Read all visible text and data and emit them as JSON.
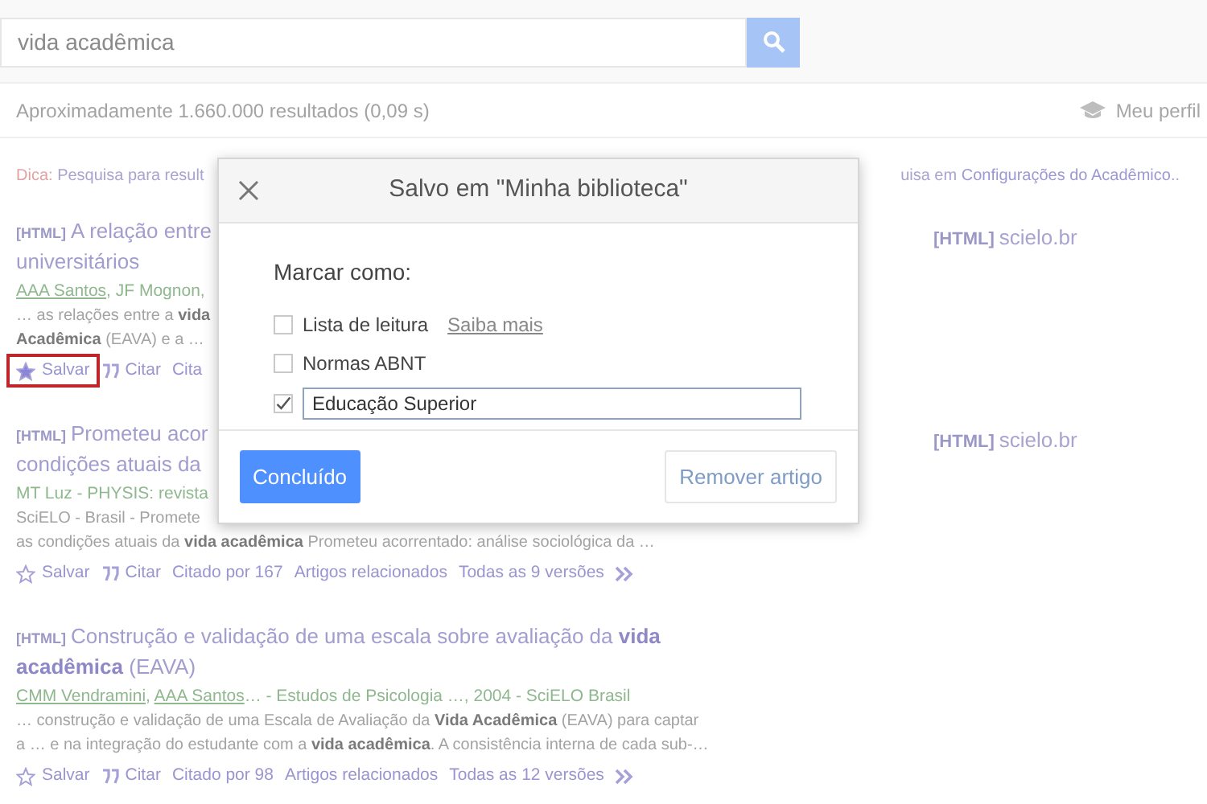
{
  "search": {
    "value": "vida acadêmica"
  },
  "results_count": "Aproximadamente 1.660.000 resultados (0,09 s)",
  "profile_link": "Meu perfil",
  "tip": {
    "label": "Dica:",
    "text_left": "Pesquisa para result",
    "text_right_prefix": "uisa em",
    "text_right_link": "Configurações do Acadêmico",
    "text_right_suffix": ".."
  },
  "results": [
    {
      "tag": "[HTML]",
      "title_lines": [
        "A relação entre",
        "universitários"
      ],
      "authors": [
        {
          "text": "AAA Santos",
          "linked": true
        },
        {
          "text": ", JF Mognon,",
          "linked": false
        }
      ],
      "snippet_lines": [
        "… as relações entre a **vida**",
        "**Acadêmica** (EAVA) e a …"
      ],
      "actions": [
        {
          "kind": "save",
          "label": "Salvar",
          "saved": true,
          "highlighted": true
        },
        {
          "kind": "cite",
          "label": "Citar"
        },
        {
          "kind": "link",
          "label": "Cita"
        }
      ],
      "side_link": {
        "tag": "[HTML]",
        "text": "scielo.br"
      }
    },
    {
      "tag": "[HTML]",
      "title_lines": [
        "Prometeu acor",
        "condições atuais da"
      ],
      "authors": [
        {
          "text": "MT Luz - PHYSIS: revista",
          "linked": false
        }
      ],
      "snippet_lines": [
        "SciELO - Brasil - Promete",
        "as condições atuais da **vida acadêmica** Prometeu acorrentado: análise sociológica da …"
      ],
      "actions": [
        {
          "kind": "save",
          "label": "Salvar",
          "saved": false,
          "highlighted": false
        },
        {
          "kind": "cite",
          "label": "Citar"
        },
        {
          "kind": "link",
          "label": "Citado por 167"
        },
        {
          "kind": "link",
          "label": "Artigos relacionados"
        },
        {
          "kind": "link",
          "label": "Todas as 9 versões"
        },
        {
          "kind": "more"
        }
      ],
      "side_link": {
        "tag": "[HTML]",
        "text": "scielo.br"
      }
    },
    {
      "tag": "[HTML]",
      "title_lines": [
        "Construção e validação de uma escala sobre avaliação da **vida**",
        "**acadêmica** (EAVA)"
      ],
      "authors": [
        {
          "text": "CMM Vendramini",
          "linked": true
        },
        {
          "text": ", ",
          "linked": false
        },
        {
          "text": "AAA Santos",
          "linked": true
        },
        {
          "text": "… - Estudos de Psicologia …, 2004 - SciELO Brasil",
          "linked": false
        }
      ],
      "snippet_lines": [
        "… construção e validação de uma Escala de Avaliação da **Vida Acadêmica** (EAVA) para captar",
        "a … e na integração do estudante com a **vida acadêmica**. A consistência interna de cada sub-…"
      ],
      "actions": [
        {
          "kind": "save",
          "label": "Salvar",
          "saved": false,
          "highlighted": false
        },
        {
          "kind": "cite",
          "label": "Citar"
        },
        {
          "kind": "link",
          "label": "Citado por 98"
        },
        {
          "kind": "link",
          "label": "Artigos relacionados"
        },
        {
          "kind": "link",
          "label": "Todas as 12 versões"
        },
        {
          "kind": "more"
        }
      ]
    }
  ],
  "dialog": {
    "title": "Salvo em \"Minha biblioteca\"",
    "prompt": "Marcar como:",
    "options": [
      {
        "kind": "checkbox",
        "label": "Lista de leitura",
        "checked": false,
        "link": "Saiba mais"
      },
      {
        "kind": "checkbox",
        "label": "Normas ABNT",
        "checked": false
      },
      {
        "kind": "input",
        "value": "Educação Superior",
        "checked": true
      }
    ],
    "primary_button": "Concluído",
    "secondary_button": "Remover artigo"
  }
}
